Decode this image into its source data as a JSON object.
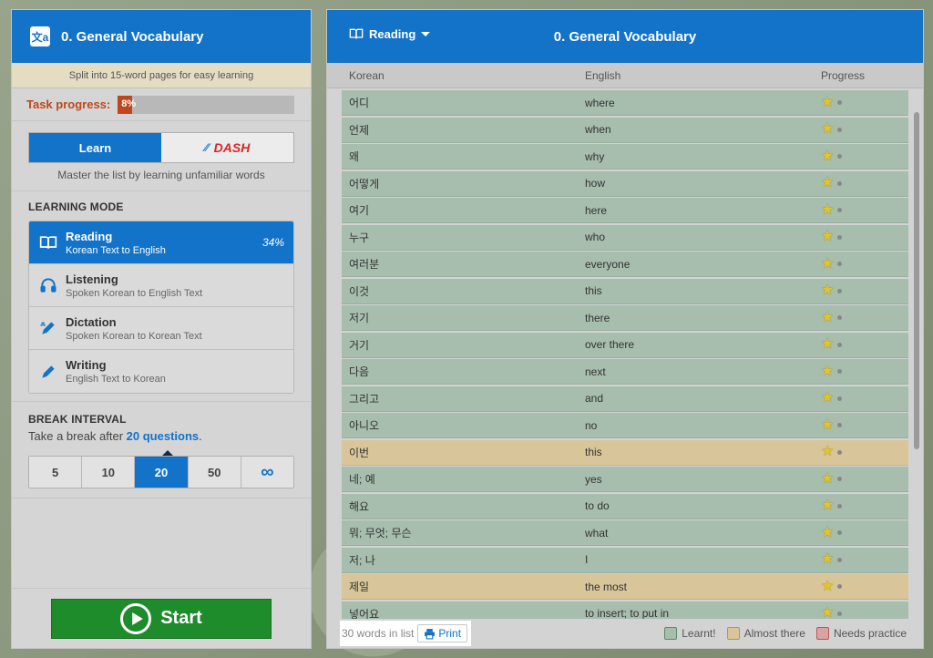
{
  "left": {
    "title": "0. General Vocabulary",
    "split_note": "Split into 15-word pages for easy learning",
    "task_label": "Task progress:",
    "task_percent": "8%",
    "task_fraction": 0.08,
    "learn_label": "Learn",
    "dash_label": "DASH",
    "learn_desc": "Master the list by learning unfamiliar words",
    "mode_heading": "LEARNING MODE",
    "modes": [
      {
        "title": "Reading",
        "sub": "Korean Text to English",
        "pct": "34%"
      },
      {
        "title": "Listening",
        "sub": "Spoken Korean to English Text"
      },
      {
        "title": "Dictation",
        "sub": "Spoken Korean to Korean Text"
      },
      {
        "title": "Writing",
        "sub": "English Text to Korean"
      }
    ],
    "break_heading": "BREAK INTERVAL",
    "break_pre": "Take a break after ",
    "break_value": "20 questions",
    "break_post": ".",
    "intervals": [
      "5",
      "10",
      "20",
      "50",
      "∞"
    ],
    "start_label": "Start"
  },
  "right": {
    "mode_label": "Reading",
    "title": "0. General Vocabulary",
    "col_korean": "Korean",
    "col_english": "English",
    "col_progress": "Progress",
    "rows": [
      {
        "ko": "어디",
        "en": "where"
      },
      {
        "ko": "언제",
        "en": "when"
      },
      {
        "ko": "왜",
        "en": "why"
      },
      {
        "ko": "어떻게",
        "en": "how"
      },
      {
        "ko": "여기",
        "en": "here"
      },
      {
        "ko": "누구",
        "en": "who"
      },
      {
        "ko": "여러분",
        "en": "everyone"
      },
      {
        "ko": "이것",
        "en": "this"
      },
      {
        "ko": "저기",
        "en": "there"
      },
      {
        "ko": "거기",
        "en": "over there"
      },
      {
        "ko": "다음",
        "en": "next"
      },
      {
        "ko": "그리고",
        "en": "and"
      },
      {
        "ko": "아니오",
        "en": "no"
      },
      {
        "ko": "이번",
        "en": "this",
        "status": "almost"
      },
      {
        "ko": "네; 예",
        "en": "yes"
      },
      {
        "ko": "해요",
        "en": "to do"
      },
      {
        "ko": "뭐; 무엇; 무슨",
        "en": "what"
      },
      {
        "ko": "저; 나",
        "en": "I"
      },
      {
        "ko": "제일",
        "en": "the most",
        "status": "almost"
      },
      {
        "ko": "넣어요",
        "en": "to insert; to put in"
      }
    ],
    "word_count": "30 words in list",
    "print_label": "Print",
    "legend": {
      "learnt": "Learnt!",
      "almost": "Almost there",
      "needs": "Needs practice"
    }
  },
  "colors": {
    "primary": "#1273c8",
    "learnt": "#a7bdad",
    "almost": "#d8c59a",
    "needs": "#d9a3a3",
    "start": "#1f8c2b",
    "task": "#c0471b"
  }
}
